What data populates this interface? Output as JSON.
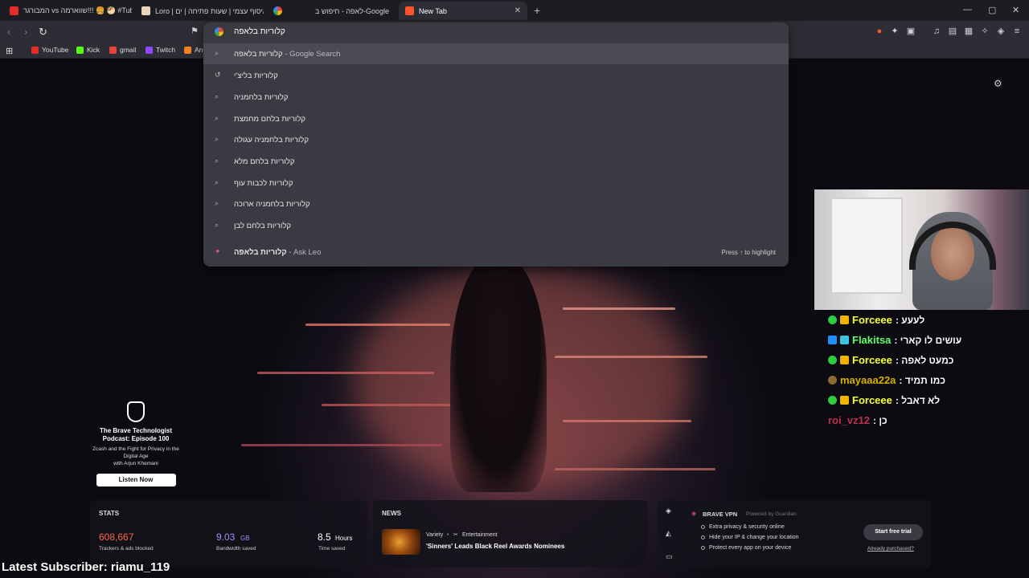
{
  "tabs": [
    {
      "label": "המבורגר vs שווארמה!!! 🍔 🥙 #Tube",
      "favicon_color": "#e52d27"
    },
    {
      "label": "Loro | איסוף עצמי | שעות פתיחה | ים",
      "favicon_color": "#e6d5b8"
    },
    {
      "label": "",
      "favicon_color": "#4285f4"
    },
    {
      "label": "לאפה - חיפוש ב-Google",
      "favicon_color": ""
    },
    {
      "label": "New Tab",
      "favicon_color": "#fb542b",
      "active": true
    }
  ],
  "window_controls": {
    "minimize": "—",
    "maximize": "▢",
    "close": "✕"
  },
  "new_tab_symbol": "+",
  "bookmarks": [
    {
      "label": "YouTube",
      "color": "#e52d27"
    },
    {
      "label": "Kick",
      "color": "#53fc18"
    },
    {
      "label": "gmail",
      "color": "#ea4335"
    },
    {
      "label": "Twitch",
      "color": "#9146ff"
    },
    {
      "label": "An",
      "color": "#f48120"
    }
  ],
  "omnibox": {
    "query": "קלוריות בלאפה",
    "suggestions": [
      {
        "icon": "search",
        "text": "קלוריות בלאפה",
        "suffix": " - Google Search"
      },
      {
        "icon": "history",
        "text": "קלוריות בליצ'י",
        "suffix": ""
      },
      {
        "icon": "search",
        "text": "קלוריות בלחמניה",
        "suffix": ""
      },
      {
        "icon": "search",
        "text": "קלוריות בלחם מחמצת",
        "suffix": ""
      },
      {
        "icon": "search",
        "text": "קלוריות בלחמניה עגולה",
        "suffix": ""
      },
      {
        "icon": "search",
        "text": "קלוריות בלחם מלא",
        "suffix": ""
      },
      {
        "icon": "search",
        "text": "קלוריות לכבות עוף",
        "suffix": ""
      },
      {
        "icon": "search",
        "text": "קלוריות בלחמניה ארוכה",
        "suffix": ""
      },
      {
        "icon": "search",
        "text": "קלוריות בלחם לבן",
        "suffix": ""
      }
    ],
    "leo": {
      "text": "קלוריות בלאפה",
      "suffix": " - Ask Leo",
      "hint": "Press ↑ to highlight"
    }
  },
  "chat": [
    {
      "name": "Forceee",
      "message": ": לעעע",
      "name_color": "#f4ff3a",
      "badges": [
        "#2ecc40",
        "#f0b400"
      ]
    },
    {
      "name": "Flakitsa",
      "message": ": עושים לו קארי",
      "name_color": "#5fff6a",
      "badges": [
        "#1e90ff",
        "#3cc3e0"
      ]
    },
    {
      "name": "Forceee",
      "message": ": כמעט לאפה",
      "name_color": "#f4ff3a",
      "badges": [
        "#2ecc40",
        "#f0b400"
      ]
    },
    {
      "name": "mayaaa22a",
      "message": ": כמו תמיד",
      "name_color": "#d4b000",
      "badges": [
        "#8a6a30"
      ]
    },
    {
      "name": "Forceee",
      "message": ": לא דאבל",
      "name_color": "#f4ff3a",
      "badges": [
        "#2ecc40",
        "#f0b400"
      ]
    },
    {
      "name": "roi_vz12",
      "message": ": כן",
      "name_color": "#c0304a",
      "badges": []
    }
  ],
  "podcast": {
    "title": "The Brave Technologist Podcast: Episode 100",
    "subtitle": "Zcash and the Fight for Privacy in the Digital Age",
    "with": "with Arjun Khemani",
    "cta": "Listen Now"
  },
  "stats": {
    "heading": "STATS",
    "trackers": {
      "value": "608,667",
      "label": "Trackers & ads blocked",
      "color": "#fb6a4a"
    },
    "bandwidth": {
      "value": "9.03",
      "unit": "GB",
      "label": "Bandwidth saved",
      "color": "#a38bff"
    },
    "time": {
      "value": "8.5",
      "unit": "Hours",
      "label": "Time saved",
      "color": "#ffffff"
    }
  },
  "news": {
    "heading": "NEWS",
    "source": "Variety",
    "category": "Entertainment",
    "headline": "'Sinners' Leads Black Reel Awards Nominees"
  },
  "vpn": {
    "title": "BRAVE VPN",
    "powered": "Powered by Guardian",
    "features": [
      "Extra privacy & security online",
      "Hide your IP & change your location",
      "Protect every app on your device"
    ],
    "cta": "Start free trial",
    "link": "Already purchased?"
  },
  "subscriber_banner": "Latest Subscriber: riamu_119"
}
